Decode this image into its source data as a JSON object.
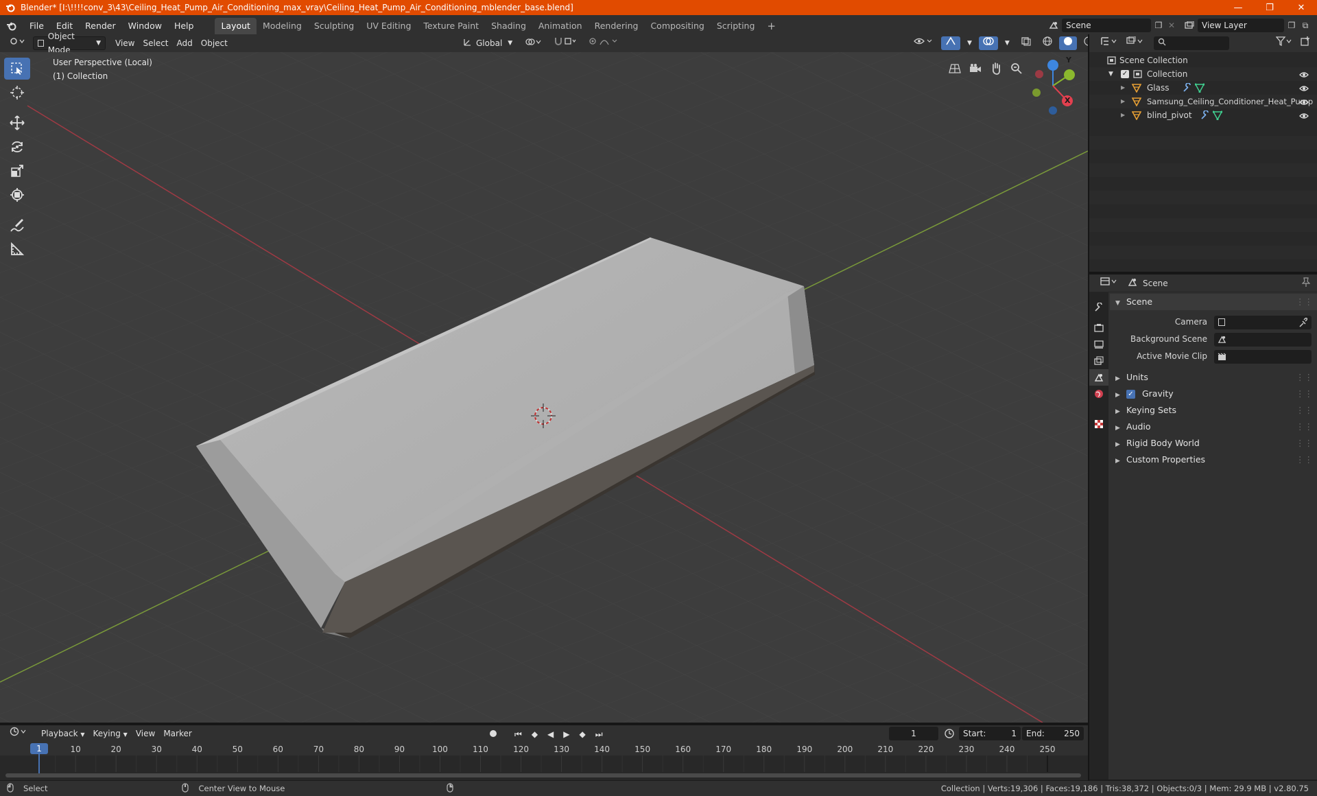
{
  "window": {
    "title": "Blender* [I:\\!!!!conv_3\\43\\Ceiling_Heat_Pump_Air_Conditioning_max_vray\\Ceiling_Heat_Pump_Air_Conditioning_mblender_base.blend]",
    "minimize": "—",
    "maximize": "❐",
    "close": "✕"
  },
  "menu": {
    "items": [
      "File",
      "Edit",
      "Render",
      "Window",
      "Help"
    ],
    "workspaces": [
      "Layout",
      "Modeling",
      "Sculpting",
      "UV Editing",
      "Texture Paint",
      "Shading",
      "Animation",
      "Rendering",
      "Compositing",
      "Scripting"
    ],
    "active_workspace": "Layout",
    "add_workspace": "+",
    "scene": "Scene",
    "view_layer": "View Layer"
  },
  "viewport_header": {
    "mode": "Object Mode",
    "menus": [
      "View",
      "Select",
      "Add",
      "Object"
    ],
    "transform_orientation": "Global"
  },
  "viewport": {
    "perspective_label": "User Perspective (Local)",
    "collection_label": "(1) Collection",
    "gizmo_axes": [
      "Z",
      "Y",
      "X"
    ]
  },
  "outliner": {
    "search_placeholder": "",
    "root": "Scene Collection",
    "collection": "Collection",
    "objects": [
      "Glass",
      "Samsung_Ceiling_Conditioner_Heat_Pump",
      "blind_pivot"
    ]
  },
  "properties": {
    "header_title": "Scene",
    "panel_title": "Scene",
    "fields": [
      {
        "label": "Camera",
        "value": ""
      },
      {
        "label": "Background Scene",
        "value": ""
      },
      {
        "label": "Active Movie Clip",
        "value": ""
      }
    ],
    "sections": [
      "Units",
      "Gravity",
      "Keying Sets",
      "Audio",
      "Rigid Body World",
      "Custom Properties"
    ],
    "gravity_checked": true
  },
  "timeline": {
    "menus": [
      "Playback",
      "Keying",
      "View",
      "Marker"
    ],
    "current_frame": "1",
    "start_label": "Start:",
    "start": "1",
    "end_label": "End:",
    "end": "250",
    "ticks": [
      "1",
      "10",
      "20",
      "30",
      "40",
      "50",
      "60",
      "70",
      "80",
      "90",
      "100",
      "110",
      "120",
      "130",
      "140",
      "150",
      "160",
      "170",
      "180",
      "190",
      "200",
      "210",
      "220",
      "230",
      "240",
      "250"
    ]
  },
  "status": {
    "select": "Select",
    "center_view": "Center View to Mouse",
    "info": "Collection | Verts:19,306 | Faces:19,186 | Tris:38,372 | Objects:0/3 | Mem: 29.9 MB | v2.80.75"
  },
  "colors": {
    "accent": "#4772b3",
    "titlebar": "#e14b00",
    "x_axis": "#e2404f",
    "y_axis": "#8bb82e",
    "z_axis": "#3d86e0"
  }
}
